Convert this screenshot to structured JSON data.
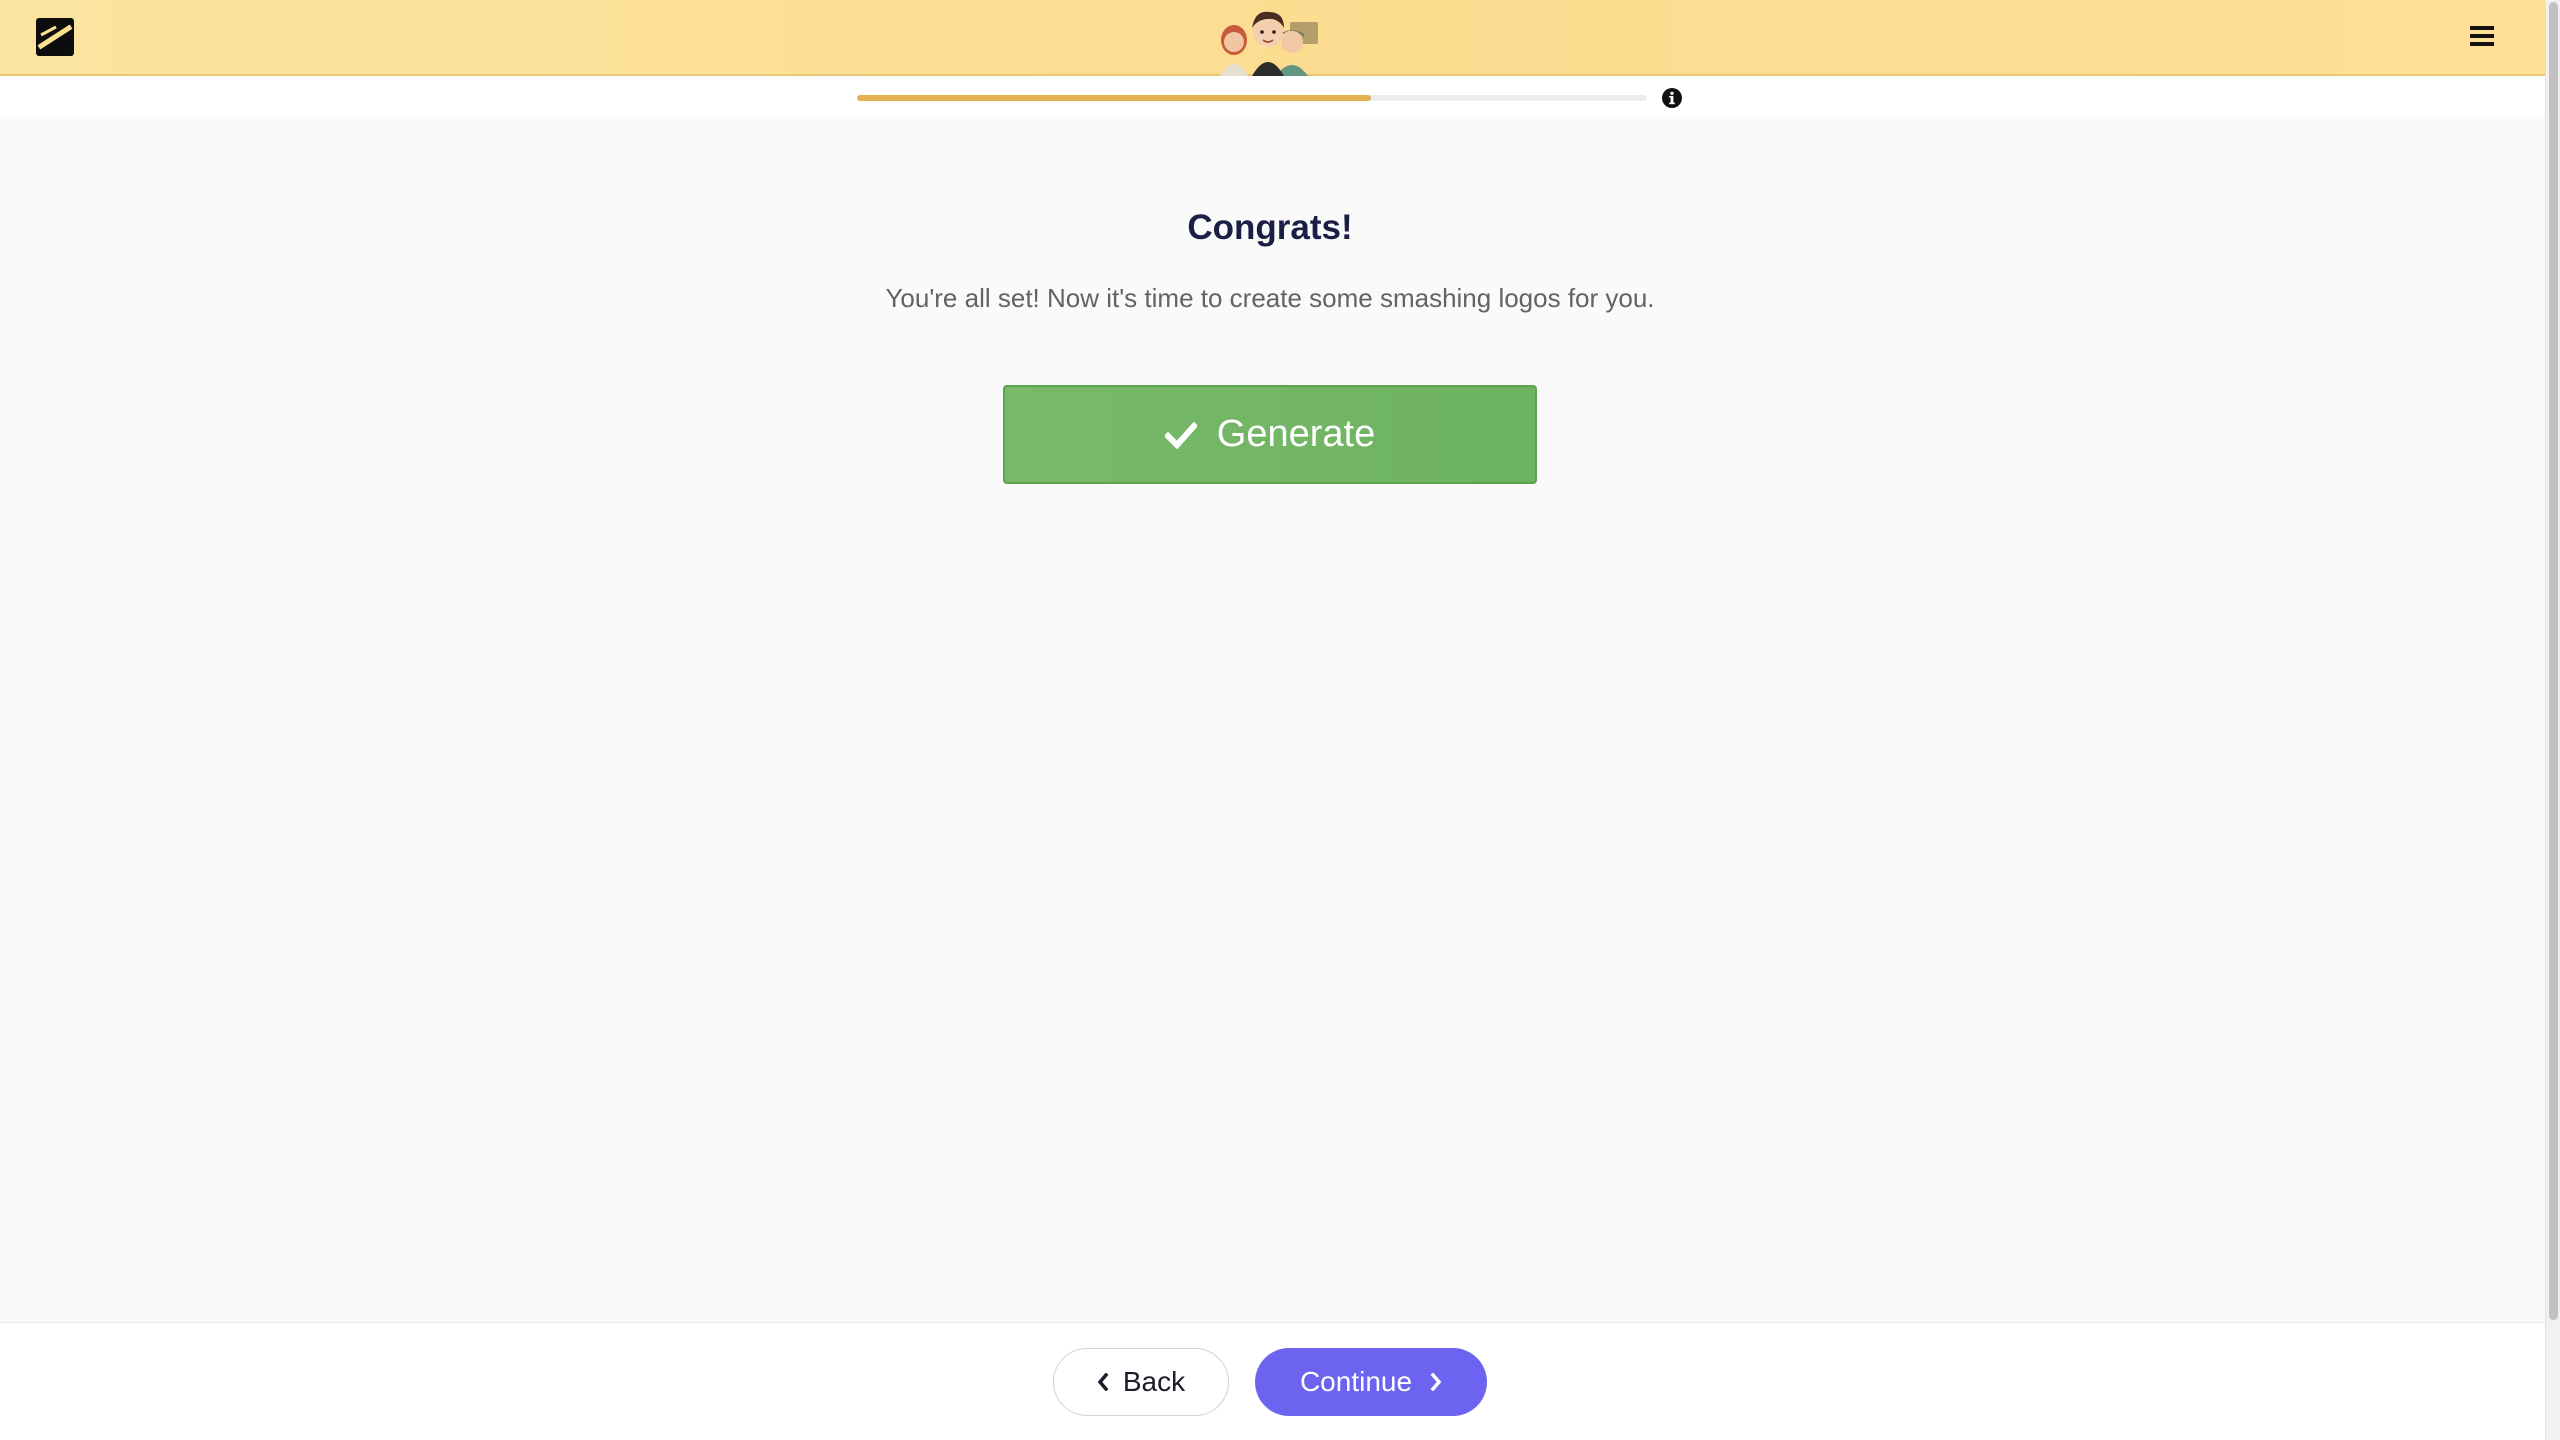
{
  "header": {
    "logo_icon": "smashing-logo-icon",
    "menu_icon": "hamburger-menu-icon",
    "avatar_icon": "team-avatars-illustration"
  },
  "progress": {
    "fraction": 0.65,
    "fill_color": "#e3b253",
    "info_icon": "info-circle-icon"
  },
  "main": {
    "title": "Congrats!",
    "subtitle": "You're all set! Now it's time to create some smashing logos for you.",
    "generate_label": "Generate",
    "generate_icon": "checkmark-icon",
    "generate_color": "#74b667"
  },
  "footer": {
    "back_label": "Back",
    "back_icon": "chevron-left-icon",
    "continue_label": "Continue",
    "continue_icon": "chevron-right-icon",
    "continue_color": "#6c63f0"
  }
}
